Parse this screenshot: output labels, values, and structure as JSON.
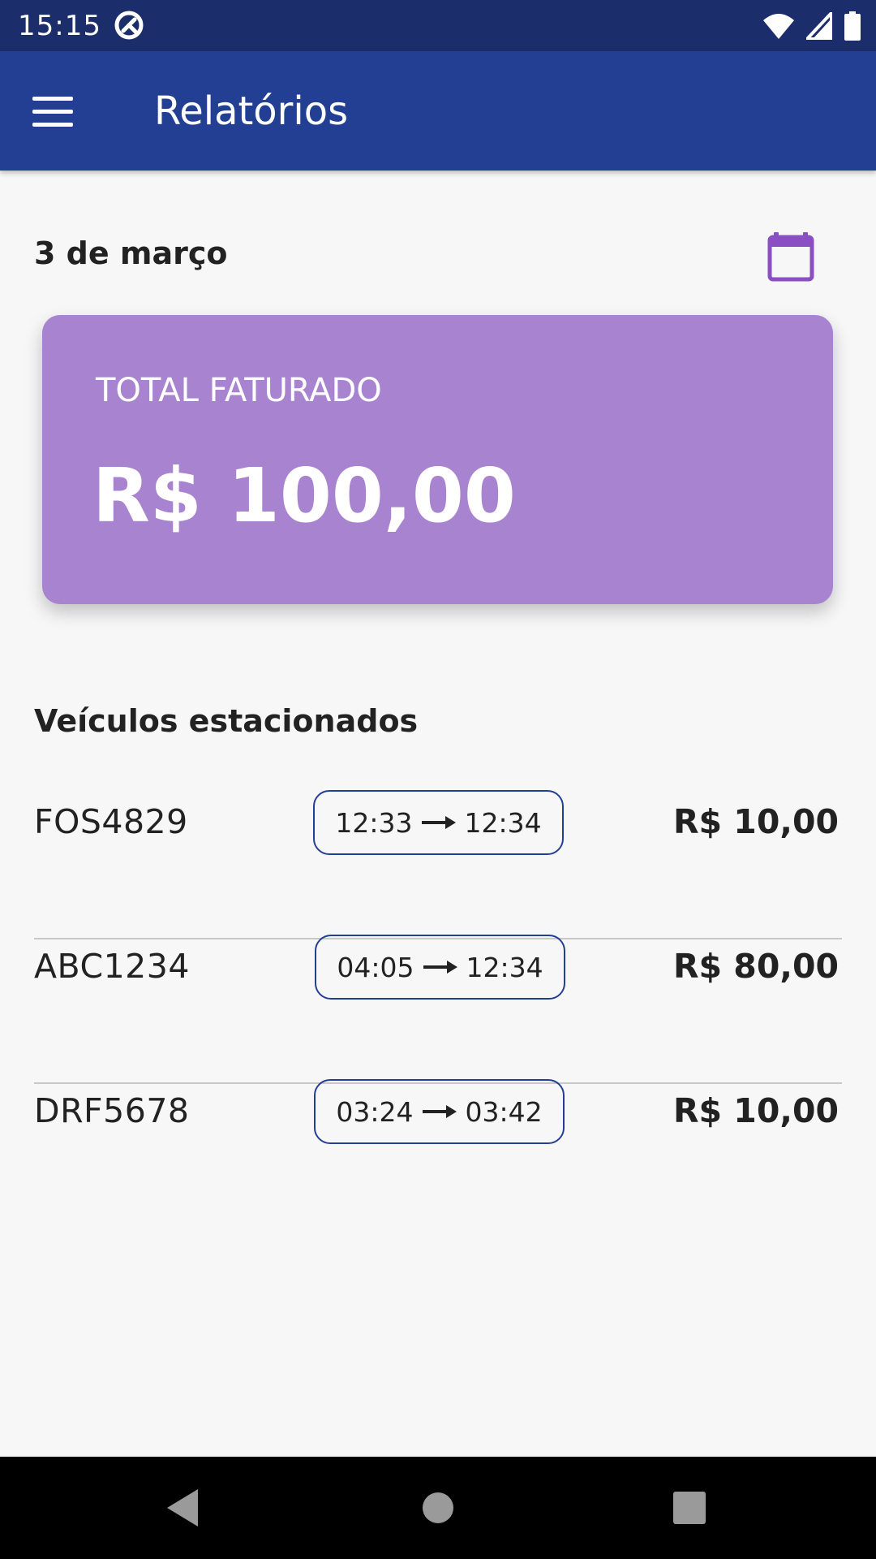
{
  "status_bar": {
    "time": "15:15",
    "icons": [
      "app-notification-icon",
      "wifi-icon",
      "signal-icon",
      "battery-icon"
    ]
  },
  "app_bar": {
    "title": "Relatórios",
    "menu_icon": "hamburger-menu-icon"
  },
  "report": {
    "date": "3 de março",
    "calendar_icon": "calendar-icon",
    "total_label": "TOTAL FATURADO",
    "total_value": "R$ 100,00"
  },
  "vehicles": {
    "title": "Veículos estacionados",
    "items": [
      {
        "plate": "FOS4829",
        "entry": "12:33",
        "exit": "12:34",
        "amount": "R$ 10,00"
      },
      {
        "plate": "ABC1234",
        "entry": "04:05",
        "exit": "12:34",
        "amount": "R$ 80,00"
      },
      {
        "plate": "DRF5678",
        "entry": "03:24",
        "exit": "03:42",
        "amount": "R$ 10,00"
      }
    ]
  },
  "nav_bar": {
    "icons": [
      "back-icon",
      "home-icon",
      "recents-icon"
    ]
  },
  "colors": {
    "status_bar": "#1c2d6b",
    "app_bar": "#233f94",
    "card": "#a883cf",
    "accent": "#8a4fc2",
    "pill_border": "#233f94",
    "background": "#f7f7f8"
  }
}
